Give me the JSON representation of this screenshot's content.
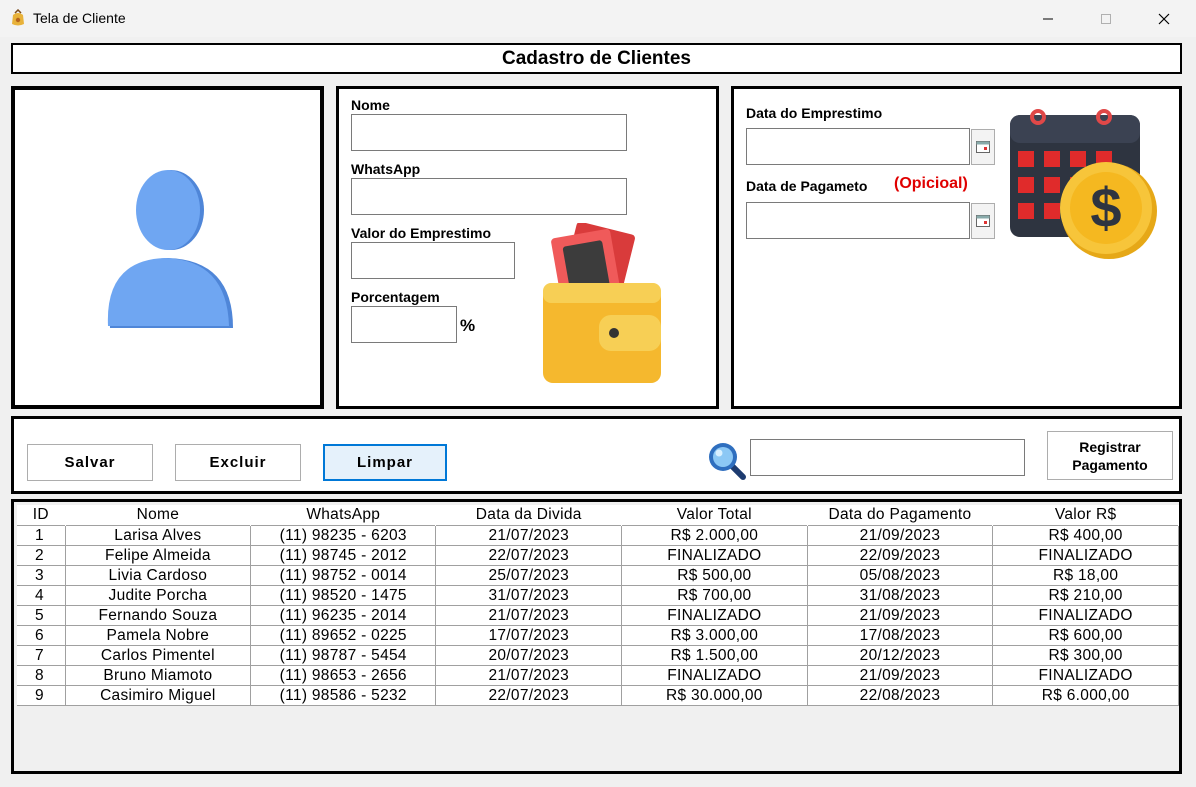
{
  "window": {
    "title": "Tela de Cliente"
  },
  "header": {
    "title": "Cadastro de Clientes"
  },
  "form": {
    "nome_label": "Nome",
    "whatsapp_label": "WhatsApp",
    "valor_label": "Valor do Emprestimo",
    "porcentagem_label": "Porcentagem",
    "percent_symbol": "%",
    "data_emprestimo_label": "Data do Emprestimo",
    "data_pagamento_label": "Data de Pagameto",
    "opcional_label": "(Opicioal)",
    "nome_value": "",
    "whatsapp_value": "",
    "valor_value": "",
    "porcentagem_value": "",
    "data_emprestimo_value": "",
    "data_pagamento_value": ""
  },
  "actions": {
    "salvar": "Salvar",
    "excluir": "Excluir",
    "limpar": "Limpar",
    "registrar_line1": "Registrar",
    "registrar_line2": "Pagamento",
    "search_value": ""
  },
  "colors": {
    "accent_red": "#e00000",
    "focus_blue": "#0078d7",
    "user_icon": "#5c9cf0"
  },
  "icons": {
    "user": "user-avatar-icon",
    "wallet": "wallet-money-icon",
    "calendar": "calendar-coin-icon",
    "search": "magnifier-icon"
  },
  "table": {
    "columns": [
      "ID",
      "Nome",
      "WhatsApp",
      "Data da Divida",
      "Valor Total",
      "Data do Pagamento",
      "Valor R$"
    ],
    "rows": [
      [
        "1",
        "Larisa Alves",
        "(11) 98235 - 6203",
        "21/07/2023",
        "R$ 2.000,00",
        "21/09/2023",
        "R$ 400,00"
      ],
      [
        "2",
        "Felipe Almeida",
        "(11) 98745 - 2012",
        "22/07/2023",
        "FINALIZADO",
        "22/09/2023",
        "FINALIZADO"
      ],
      [
        "3",
        "Livia Cardoso",
        "(11) 98752 - 0014",
        "25/07/2023",
        "R$ 500,00",
        "05/08/2023",
        "R$ 18,00"
      ],
      [
        "4",
        "Judite Porcha",
        "(11) 98520 - 1475",
        "31/07/2023",
        "R$ 700,00",
        "31/08/2023",
        "R$ 210,00"
      ],
      [
        "5",
        "Fernando Souza",
        "(11) 96235 - 2014",
        "21/07/2023",
        "FINALIZADO",
        "21/09/2023",
        "FINALIZADO"
      ],
      [
        "6",
        "Pamela Nobre",
        "(11) 89652 - 0225",
        "17/07/2023",
        "R$ 3.000,00",
        "17/08/2023",
        "R$ 600,00"
      ],
      [
        "7",
        "Carlos Pimentel",
        "(11) 98787 - 5454",
        "20/07/2023",
        "R$ 1.500,00",
        "20/12/2023",
        "R$ 300,00"
      ],
      [
        "8",
        "Bruno Miamoto",
        "(11) 98653 - 2656",
        "21/07/2023",
        "FINALIZADO",
        "21/09/2023",
        "FINALIZADO"
      ],
      [
        "9",
        "Casimiro Miguel",
        "(11) 98586 - 5232",
        "22/07/2023",
        "R$ 30.000,00",
        "22/08/2023",
        "R$ 6.000,00"
      ]
    ]
  }
}
